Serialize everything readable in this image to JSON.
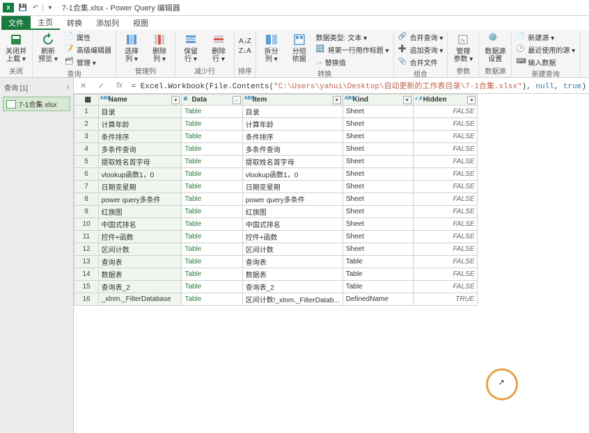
{
  "title": "7-1合集.xlsx - Power Query 编辑器",
  "menu": {
    "file": "文件",
    "tabs": [
      "主页",
      "转换",
      "添加列",
      "视图"
    ]
  },
  "ribbon": {
    "close": {
      "label": "关闭并\n上载 ▾",
      "group": "关闭"
    },
    "refresh": {
      "label": "刷新\n预览 ▾",
      "props": "属性",
      "adv": "高级编辑器",
      "manage": "管理 ▾",
      "group": "查询"
    },
    "cols": {
      "choose": "选择\n列 ▾",
      "remove": "删除\n列 ▾",
      "group": "管理列"
    },
    "rows": {
      "keep": "保留\n行 ▾",
      "remove": "删除\n行 ▾",
      "group": "减少行"
    },
    "sort": {
      "group": "排序"
    },
    "split": {
      "split": "拆分\n列 ▾",
      "group": "分组\n依据",
      "dtype": "数据类型: 文本 ▾",
      "first": "将第一行用作标题 ▾",
      "replace": "替换值",
      "grouplbl": "转换"
    },
    "merge": {
      "merge": "合并查询 ▾",
      "append": "追加查询 ▾",
      "combine": "合并文件",
      "group": "组合"
    },
    "params": {
      "label": "管理\n参数 ▾",
      "group": "参数"
    },
    "ds": {
      "label": "数据源\n设置",
      "group": "数据源"
    },
    "new": {
      "new": "新建源 ▾",
      "recent": "最近使用的源 ▾",
      "input": "输入数据",
      "group": "新建查询"
    }
  },
  "side": {
    "header": "查询 [1]",
    "item": "7-1合集 xlsx"
  },
  "formula_prefix": "= Excel.Workbook(File.Contents(",
  "formula_str": "\"C:\\Users\\yahui\\Desktop\\自动更新的工作表目录\\7-1合集.xlsx\"",
  "formula_mid": "), ",
  "formula_null": "null",
  "formula_comma": ", ",
  "formula_true": "true",
  "formula_end": ")",
  "cols": {
    "name": "Name",
    "data": "Data",
    "item": "Item",
    "kind": "Kind",
    "hidden": "Hidden"
  },
  "rows": [
    {
      "n": "目录",
      "d": "Table",
      "i": "目录",
      "k": "Sheet",
      "h": "FALSE"
    },
    {
      "n": "计算年龄",
      "d": "Table",
      "i": "计算年龄",
      "k": "Sheet",
      "h": "FALSE"
    },
    {
      "n": "条件排序",
      "d": "Table",
      "i": "条件排序",
      "k": "Sheet",
      "h": "FALSE"
    },
    {
      "n": "多条件查询",
      "d": "Table",
      "i": "多条件查询",
      "k": "Sheet",
      "h": "FALSE"
    },
    {
      "n": "提取姓名首字母",
      "d": "Table",
      "i": "提取姓名首字母",
      "k": "Sheet",
      "h": "FALSE"
    },
    {
      "n": "vlookup函数1，0",
      "d": "Table",
      "i": "vlookup函数1，0",
      "k": "Sheet",
      "h": "FALSE"
    },
    {
      "n": "日期变星期",
      "d": "Table",
      "i": "日期变星期",
      "k": "Sheet",
      "h": "FALSE"
    },
    {
      "n": "power query多条件",
      "d": "Table",
      "i": "power query多条件",
      "k": "Sheet",
      "h": "FALSE"
    },
    {
      "n": "红旗图",
      "d": "Table",
      "i": "红旗图",
      "k": "Sheet",
      "h": "FALSE"
    },
    {
      "n": "中国式排名",
      "d": "Table",
      "i": "中国式排名",
      "k": "Sheet",
      "h": "FALSE"
    },
    {
      "n": "控件+函数",
      "d": "Table",
      "i": "控件+函数",
      "k": "Sheet",
      "h": "FALSE"
    },
    {
      "n": "区间计数",
      "d": "Table",
      "i": "区间计数",
      "k": "Sheet",
      "h": "FALSE"
    },
    {
      "n": "查询表",
      "d": "Table",
      "i": "查询表",
      "k": "Table",
      "h": "FALSE"
    },
    {
      "n": "数据表",
      "d": "Table",
      "i": "数据表",
      "k": "Table",
      "h": "FALSE"
    },
    {
      "n": "查询表_2",
      "d": "Table",
      "i": "查询表_2",
      "k": "Table",
      "h": "FALSE"
    },
    {
      "n": "_xlnm._FilterDatabase",
      "d": "Table",
      "i": "区间计数!_xlnm._FilterDatab...",
      "k": "DefinedName",
      "h": "TRUE"
    }
  ]
}
